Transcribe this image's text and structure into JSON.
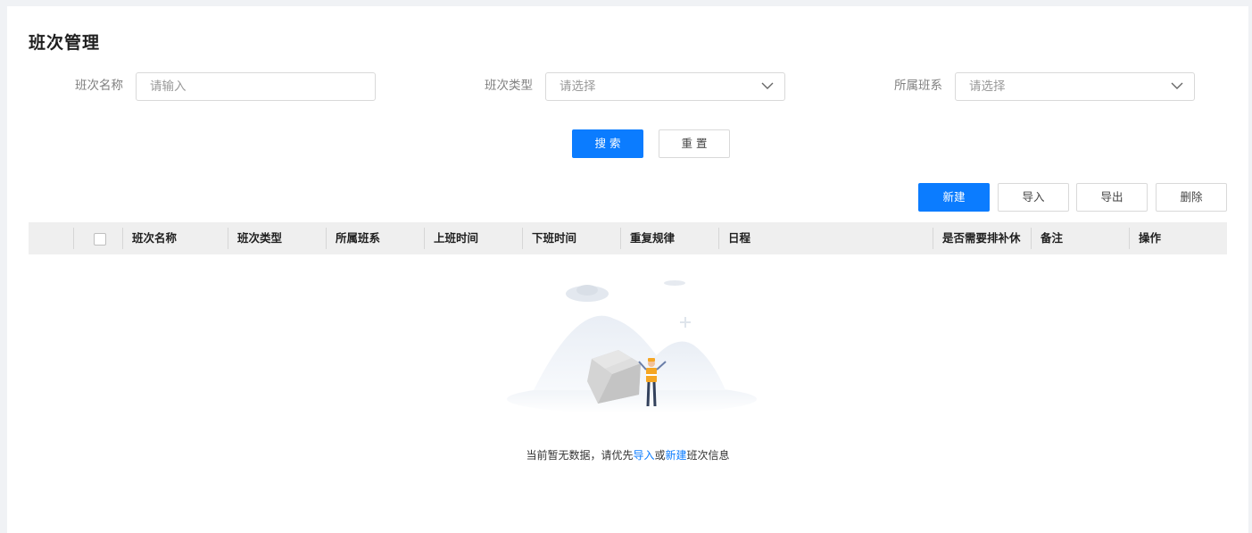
{
  "page": {
    "title": "班次管理"
  },
  "filters": {
    "shift_name": {
      "label": "班次名称",
      "placeholder": "请输入"
    },
    "shift_type": {
      "label": "班次类型",
      "placeholder": "请选择"
    },
    "shift_system": {
      "label": "所属班系",
      "placeholder": "请选择"
    }
  },
  "search_actions": {
    "search_label": "搜 索",
    "reset_label": "重 置"
  },
  "toolbar": {
    "new_label": "新建",
    "import_label": "导入",
    "export_label": "导出",
    "delete_label": "删除"
  },
  "table": {
    "columns": [
      "班次名称",
      "班次类型",
      "所属班系",
      "上班时间",
      "下班时间",
      "重复规律",
      "日程",
      "是否需要排补休",
      "备注",
      "操作"
    ],
    "rows": []
  },
  "empty": {
    "text_before": "当前暂无数据，请优先",
    "link_import": "导入",
    "text_or": "或",
    "link_new": "新建",
    "text_after": "班次信息"
  },
  "colors": {
    "primary": "#0b7cff",
    "header_bg": "#efefef",
    "page_bg": "#f0f2f5"
  }
}
